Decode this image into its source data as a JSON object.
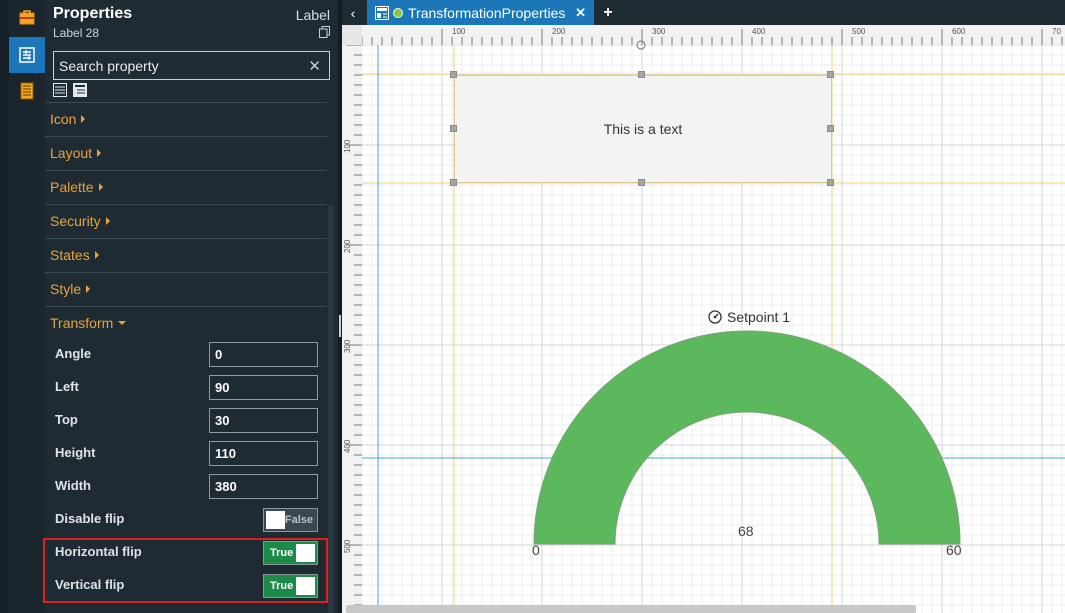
{
  "toolbar": {
    "items": [
      {
        "icon": "toolbox-icon"
      },
      {
        "icon": "properties-icon",
        "active": true
      },
      {
        "icon": "book-icon"
      }
    ]
  },
  "properties": {
    "title": "Properties",
    "subtitle": "Label 28",
    "type": "Label",
    "search": {
      "placeholder": "Search property",
      "value": ""
    },
    "sections": [
      {
        "label": "Icon"
      },
      {
        "label": "Layout"
      },
      {
        "label": "Palette"
      },
      {
        "label": "Security"
      },
      {
        "label": "States"
      },
      {
        "label": "Style"
      },
      {
        "label": "Transform"
      }
    ],
    "transform": {
      "angle": {
        "label": "Angle",
        "value": "0"
      },
      "left": {
        "label": "Left",
        "value": "90"
      },
      "top": {
        "label": "Top",
        "value": "30"
      },
      "height": {
        "label": "Height",
        "value": "110"
      },
      "width": {
        "label": "Width",
        "value": "380"
      },
      "disable_flip": {
        "label": "Disable flip",
        "state": "False"
      },
      "horizontal_flip": {
        "label": "Horizontal flip",
        "state": "True"
      },
      "vertical_flip": {
        "label": "Vertical flip",
        "state": "True"
      }
    }
  },
  "tabs": {
    "active": {
      "label": "TransformationProperties"
    }
  },
  "canvas": {
    "ruler_top_labels": [
      "100",
      "200",
      "300",
      "400",
      "500",
      "600",
      "70"
    ],
    "ruler_left_labels": [
      "100",
      "200",
      "300",
      "400",
      "500"
    ],
    "label_text": "This is a text",
    "gauge": {
      "title": "Setpoint 1",
      "value": "68",
      "min": "0",
      "max": "60",
      "color": "#5cb85c"
    }
  },
  "colors": {
    "accent": "#1b77b8",
    "section_text": "#e8a33a",
    "toggle_on": "#1e8a4a",
    "highlight": "#e0201c"
  }
}
